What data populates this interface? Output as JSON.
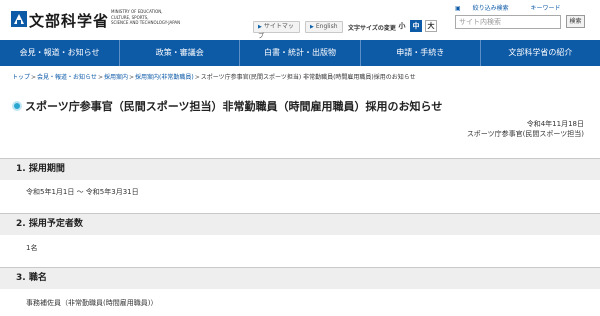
{
  "header": {
    "logo_text": "文部科学省",
    "logo_subtext": "MINISTRY OF EDUCATION,\nCULTURE, SPORTS,\nSCIENCE AND TECHNOLOGY-JAPAN",
    "sitemap_label": "サイトマップ",
    "english_label": "English",
    "font_size_label": "文字サイズの変更",
    "font_size_small": "小",
    "font_size_medium": "中",
    "font_size_large": "大",
    "search_tab_filter": "絞り込み検索",
    "search_tab_keyword": "キーワード",
    "search_placeholder": "サイト内検索",
    "search_button": "検索"
  },
  "nav": {
    "items": [
      "会見・報道・お知らせ",
      "政策・審議会",
      "白書・統計・出版物",
      "申請・手続き",
      "文部科学省の紹介"
    ]
  },
  "breadcrumb": {
    "items": [
      "トップ",
      "会見・報道・お知らせ",
      "採用案内",
      "採用案内(非常勤職員)",
      "スポーツ庁参事官(民間スポーツ担当) 非常勤職員(時間雇用職員)採用のお知らせ"
    ],
    "separator": ">"
  },
  "page": {
    "title": "スポーツ庁参事官（民間スポーツ担当）非常勤職員（時間雇用職員）採用のお知らせ",
    "date": "令和4年11月18日",
    "department": "スポーツ庁参事官(民間スポーツ担当)"
  },
  "sections": [
    {
      "heading": "1. 採用期間",
      "body": "令和5年1月1日 〜 令和5年3月31日"
    },
    {
      "heading": "2. 採用予定者数",
      "body": "1名"
    },
    {
      "heading": "3. 職名",
      "body": "事務補佐員（非常勤職員(時間雇用職員)）"
    }
  ],
  "colors": {
    "nav_background": "#0d5aa7",
    "section_background": "#eeeeee",
    "title_icon": "#2aa7d0"
  }
}
